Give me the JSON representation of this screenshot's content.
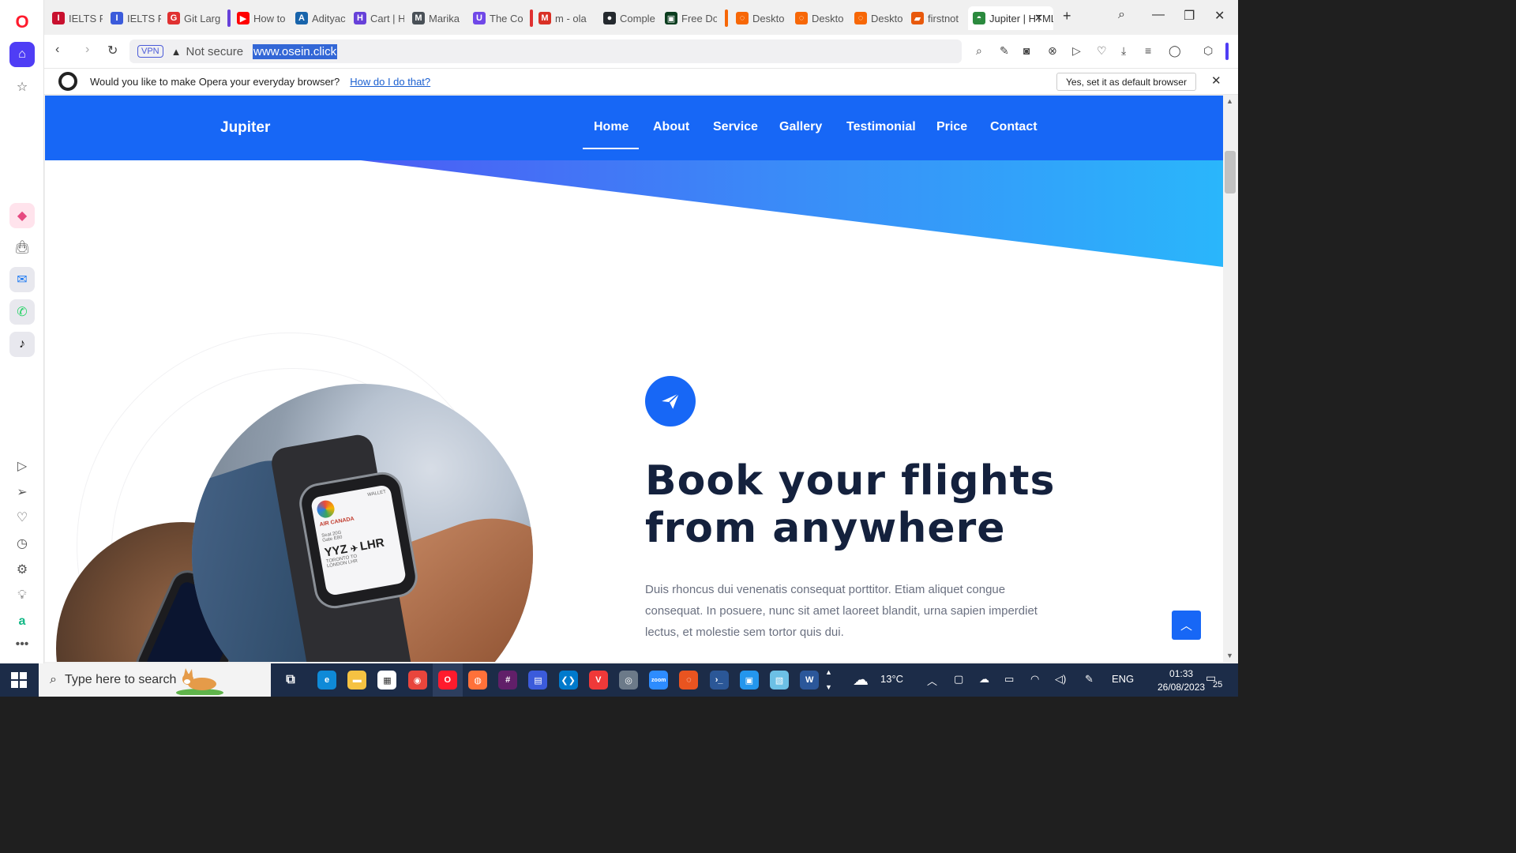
{
  "browser": {
    "tabs": [
      {
        "label": "IELTS Re",
        "color": "#c8102e",
        "fav": "I"
      },
      {
        "label": "IELTS Re",
        "color": "#3b5bdb",
        "fav": "I"
      },
      {
        "label": "Git Larg",
        "color": "#e03131",
        "fav": "G"
      },
      {
        "label": "How to",
        "color": "#ff0000",
        "fav": "▶"
      },
      {
        "label": "Adityac",
        "color": "#1864ab",
        "fav": "A"
      },
      {
        "label": "Cart | H",
        "color": "#6741d9",
        "fav": "H"
      },
      {
        "label": "Marika",
        "color": "#495057",
        "fav": "M"
      },
      {
        "label": "The Co",
        "color": "#7048e8",
        "fav": "U"
      },
      {
        "label": "m - ola",
        "color": "#d93025",
        "fav": "M"
      },
      {
        "label": "Comple",
        "color": "#24292e",
        "fav": "●"
      },
      {
        "label": "Free Do",
        "color": "#0b3d1f",
        "fav": "▣"
      },
      {
        "label": "Deskto",
        "color": "#f76707",
        "fav": "◌"
      },
      {
        "label": "Deskto",
        "color": "#f76707",
        "fav": "◌"
      },
      {
        "label": "Deskto",
        "color": "#f76707",
        "fav": "◌"
      },
      {
        "label": "firstnot",
        "color": "#e8590c",
        "fav": "▰"
      },
      {
        "label": "Jupiter | HTML",
        "color": "#2b8a3e",
        "fav": "◓"
      }
    ],
    "not_secure": "Not secure",
    "vpn": "VPN",
    "url": "www.osein.click",
    "infobar": {
      "message": "Would you like to make Opera your everyday browser?",
      "link": "How do I do that?",
      "button": "Yes, set it as default browser"
    }
  },
  "site": {
    "brand": "Jupiter",
    "nav": [
      "Home",
      "About",
      "Service",
      "Gallery",
      "Testimonial",
      "Price",
      "Contact"
    ],
    "active_nav": "Home",
    "hero": {
      "title_line1": "Book your flights",
      "title_line2": "from anywhere",
      "text": "Duis rhoncus dui venenatis consequat porttitor. Etiam aliquet congue consequat. In posuere, nunc sit amet laoreet blandit, urna sapien imperdiet lectus, et molestie sem tortor quis dui."
    },
    "watch_screen": {
      "wallet": "WALLET",
      "airline": "AIR CANADA",
      "seat": "Seat 20G",
      "gate": "Gate E80",
      "from": "YYZ",
      "to": "LHR",
      "route_small1": "TORONTO TO",
      "route_small2": "LONDON LHR"
    },
    "colors": {
      "primary": "#1767f6",
      "title": "#14213d",
      "gradient_start": "#4c5cf4",
      "gradient_end": "#2ab6fb"
    }
  },
  "taskbar": {
    "search_placeholder": "Type here to search",
    "weather": "13°C",
    "language": "ENG",
    "time": "01:33",
    "date": "26/08/2023",
    "notifications": "25"
  }
}
